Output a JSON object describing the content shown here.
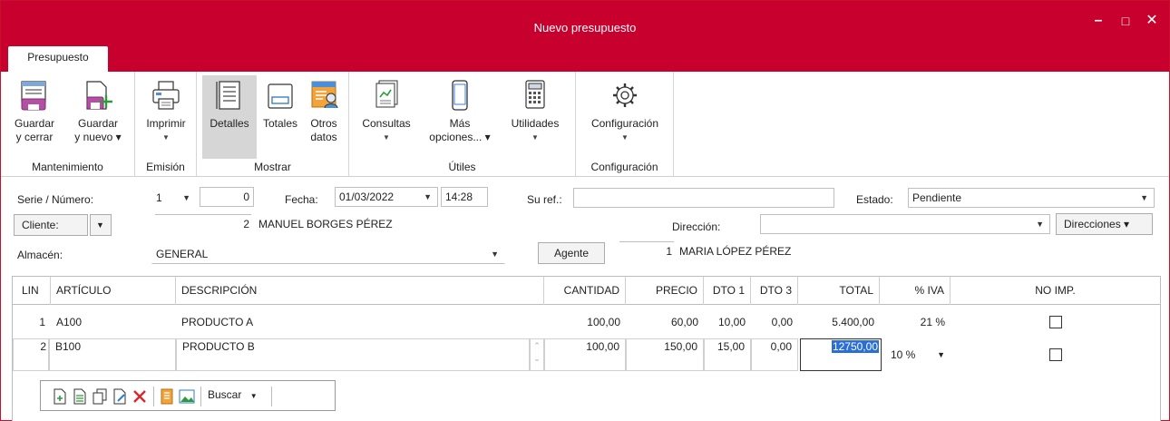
{
  "window": {
    "title": "Nuevo presupuesto"
  },
  "ribbon": {
    "tab": "Presupuesto",
    "groups": {
      "mantenimiento": "Mantenimiento",
      "emision": "Emisión",
      "mostrar": "Mostrar",
      "utiles": "Útiles",
      "configuracion": "Configuración"
    },
    "buttons": {
      "guardar_cerrar": [
        "Guardar",
        "y cerrar"
      ],
      "guardar_nuevo": [
        "Guardar",
        "y nuevo ▾"
      ],
      "imprimir": "Imprimir",
      "detalles": "Detalles",
      "totales": "Totales",
      "otros_datos": [
        "Otros",
        "datos"
      ],
      "consultas": "Consultas",
      "mas_opciones": [
        "Más",
        "opciones... ▾"
      ],
      "utilidades": "Utilidades",
      "configuracion": "Configuración"
    }
  },
  "form": {
    "serie_label": "Serie / Número:",
    "serie_value": "1",
    "numero_value": "0",
    "fecha_label": "Fecha:",
    "fecha_value": "01/03/2022",
    "hora_value": "14:28",
    "suref_label": "Su ref.:",
    "suref_value": "",
    "estado_label": "Estado:",
    "estado_value": "Pendiente",
    "cliente_button": "Cliente:",
    "cliente_code": "2",
    "cliente_name": "MANUEL BORGES PÉREZ",
    "direccion_label": "Dirección:",
    "direccion_value": "",
    "direcciones_button": "Direcciones ▾",
    "almacen_label": "Almacén:",
    "almacen_value": "GENERAL",
    "agente_button": "Agente",
    "agente_code": "1",
    "agente_name": "MARIA LÓPEZ PÉREZ"
  },
  "grid": {
    "headers": {
      "lin": "LIN",
      "articulo": "ARTÍCULO",
      "descripcion": "DESCRIPCIÓN",
      "cantidad": "CANTIDAD",
      "precio": "PRECIO",
      "dto1": "DTO 1",
      "dto3": "DTO 3",
      "total": "TOTAL",
      "iva": "% IVA",
      "noimp": "NO IMP."
    },
    "rows": [
      {
        "lin": "1",
        "articulo": "A100",
        "descripcion": "PRODUCTO A",
        "cantidad": "100,00",
        "precio": "60,00",
        "dto1": "10,00",
        "dto3": "0,00",
        "total": "5.400,00",
        "iva": "21 %"
      },
      {
        "lin": "2",
        "articulo": "B100",
        "descripcion": "PRODUCTO B",
        "cantidad": "100,00",
        "precio": "150,00",
        "dto1": "15,00",
        "dto3": "0,00",
        "total": "12750,00",
        "iva": "10 %"
      }
    ]
  },
  "mini_toolbar": {
    "buscar": "Buscar"
  },
  "colors": {
    "brand_red": "#c8002d",
    "selection_blue": "#2a6fd6"
  }
}
